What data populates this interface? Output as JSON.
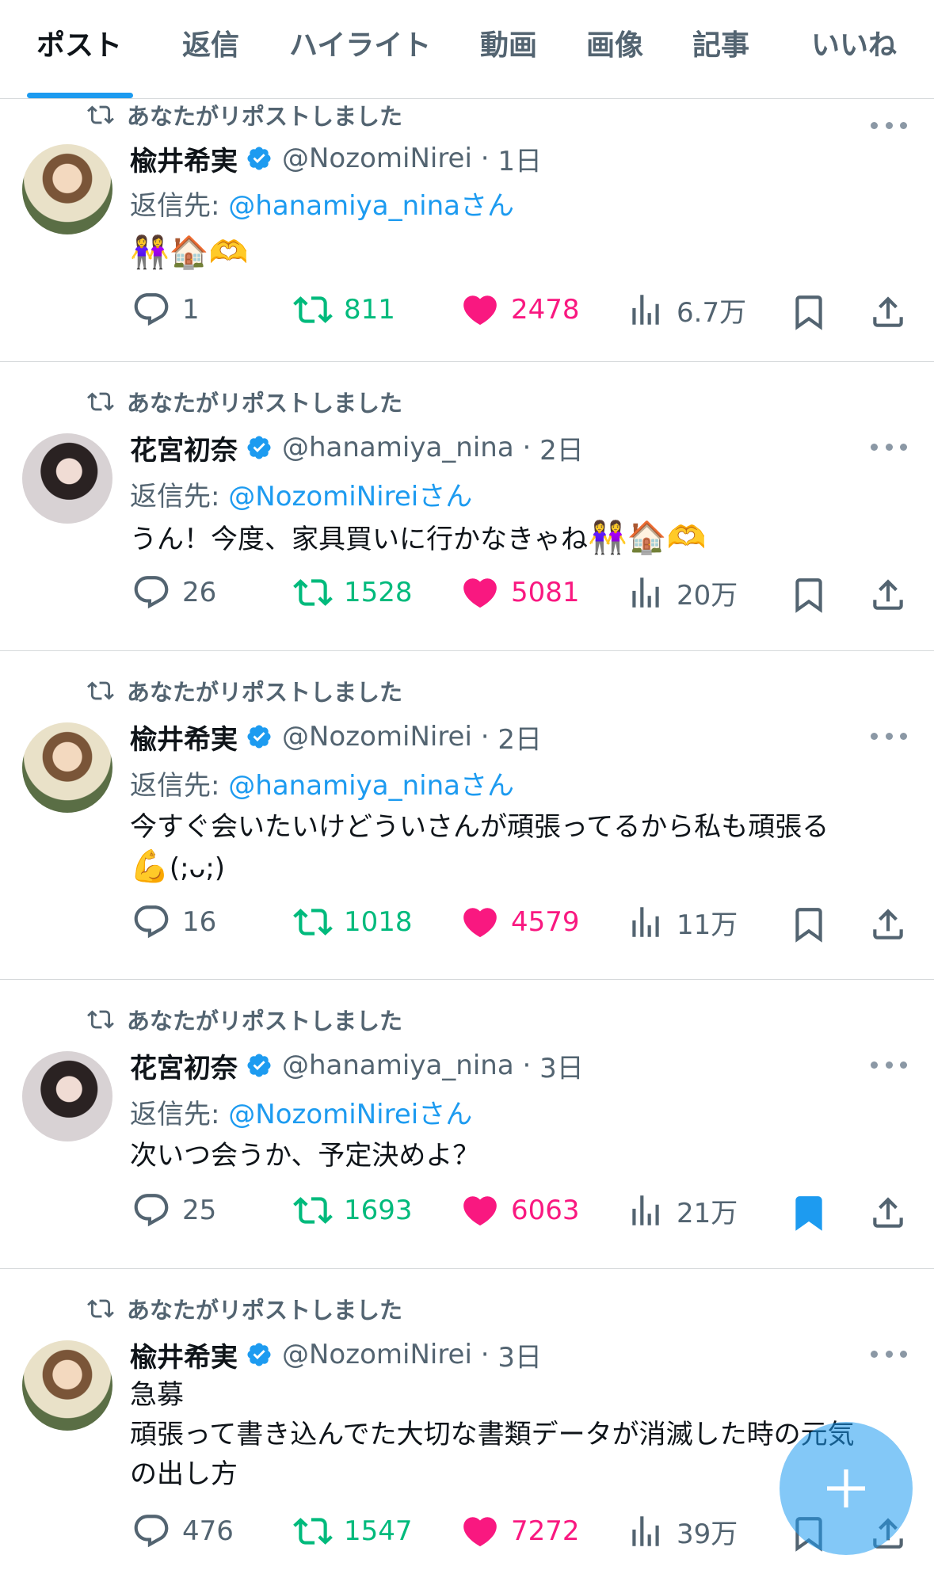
{
  "tabs": [
    {
      "label": "ポスト",
      "active": true
    },
    {
      "label": "返信"
    },
    {
      "label": "ハイライト"
    },
    {
      "label": "動画"
    },
    {
      "label": "画像"
    },
    {
      "label": "記事"
    },
    {
      "label": "いいね"
    }
  ],
  "colors": {
    "accent": "#1d9bf0",
    "repost": "#00ba7c",
    "like": "#f91880",
    "secondary": "#536471"
  },
  "posts": [
    {
      "repost_label": "あなたがリポストしました",
      "name": "楡井希実",
      "handle": "@NozomiNirei",
      "time": "1日",
      "reply_prefix": "返信先:",
      "reply_to": "@hanamiya_nina",
      "reply_suffix": "さん",
      "text": "",
      "emoji": "👭🏠🫶",
      "replies": "1",
      "reposts": "811",
      "likes": "2478",
      "views": "6.7万",
      "bookmarked": false
    },
    {
      "repost_label": "あなたがリポストしました",
      "name": "花宮初奈",
      "handle": "@hanamiya_nina",
      "time": "2日",
      "reply_prefix": "返信先:",
      "reply_to": "@NozomiNirei",
      "reply_suffix": "さん",
      "text": "うん！今度、家具買いに行かなきゃね",
      "emoji": "👭🏠🫶",
      "replies": "26",
      "reposts": "1528",
      "likes": "5081",
      "views": "20万",
      "bookmarked": false
    },
    {
      "repost_label": "あなたがリポストしました",
      "name": "楡井希実",
      "handle": "@NozomiNirei",
      "time": "2日",
      "reply_prefix": "返信先:",
      "reply_to": "@hanamiya_nina",
      "reply_suffix": "さん",
      "text": "今すぐ会いたいけどういさんが頑張ってるから私も頑張る",
      "emoji": "💪",
      "text2": "(;ᴗ;)",
      "replies": "16",
      "reposts": "1018",
      "likes": "4579",
      "views": "11万",
      "bookmarked": false
    },
    {
      "repost_label": "あなたがリポストしました",
      "name": "花宮初奈",
      "handle": "@hanamiya_nina",
      "time": "3日",
      "reply_prefix": "返信先:",
      "reply_to": "@NozomiNirei",
      "reply_suffix": "さん",
      "text": "次いつ会うか、予定決めよ？",
      "replies": "25",
      "reposts": "1693",
      "likes": "6063",
      "views": "21万",
      "bookmarked": true
    },
    {
      "repost_label": "あなたがリポストしました",
      "name": "楡井希実",
      "handle": "@NozomiNirei",
      "time": "3日",
      "text": "急募",
      "text2": "頑張って書き込んでた大切な書類データが消滅した時の元気",
      "text3": "の出し方",
      "replies": "476",
      "reposts": "1547",
      "likes": "7272",
      "views": "39万",
      "bookmarked": false
    }
  ]
}
